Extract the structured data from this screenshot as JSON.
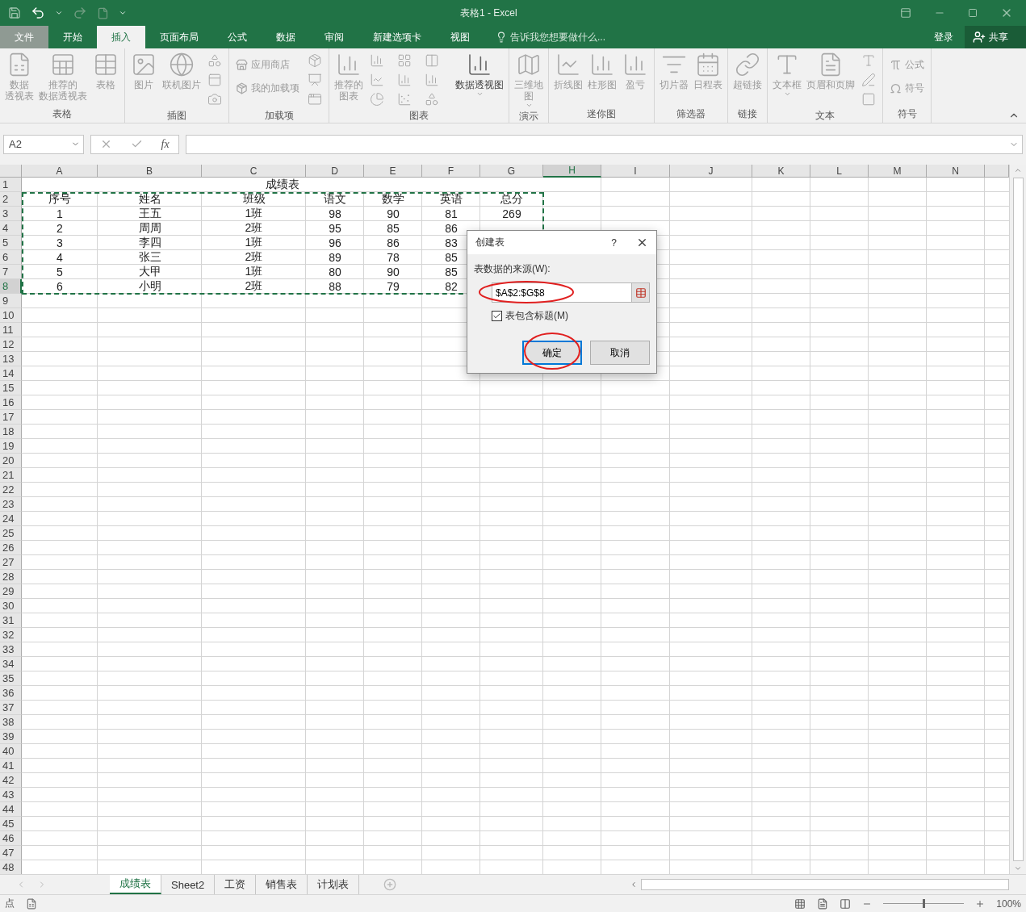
{
  "window": {
    "title": "表格1 - Excel"
  },
  "menu_tabs": [
    {
      "label": "文件",
      "selected": false,
      "kind": "file"
    },
    {
      "label": "开始",
      "selected": false,
      "kind": "tab"
    },
    {
      "label": "插入",
      "selected": true,
      "kind": "tab"
    },
    {
      "label": "页面布局",
      "selected": false,
      "kind": "tab"
    },
    {
      "label": "公式",
      "selected": false,
      "kind": "tab"
    },
    {
      "label": "数据",
      "selected": false,
      "kind": "tab"
    },
    {
      "label": "审阅",
      "selected": false,
      "kind": "tab"
    },
    {
      "label": "新建选项卡",
      "selected": false,
      "kind": "tab"
    },
    {
      "label": "视图",
      "selected": false,
      "kind": "tab"
    }
  ],
  "tell_me": {
    "placeholder": "告诉我您想要做什么..."
  },
  "sign_in": "登录",
  "share": "共享",
  "ribbon": [
    {
      "label": "表格",
      "items": [
        {
          "kind": "large",
          "lines": [
            "数据",
            "透视表"
          ],
          "disabled": true,
          "menu": false
        },
        {
          "kind": "large",
          "lines": [
            "推荐的",
            "数据透视表"
          ],
          "disabled": true,
          "menu": false
        },
        {
          "kind": "large",
          "lines": [
            "表格"
          ],
          "disabled": true,
          "menu": false
        }
      ]
    },
    {
      "label": "插图",
      "items": [
        {
          "kind": "large",
          "lines": [
            "图片"
          ],
          "disabled": true,
          "menu": false
        },
        {
          "kind": "large",
          "lines": [
            "联机图片"
          ],
          "disabled": true,
          "menu": false
        },
        {
          "kind": "icon-column"
        }
      ]
    },
    {
      "label": "加载项",
      "items": [
        {
          "kind": "small-column",
          "rows": [
            "应用商店",
            "我的加载项"
          ]
        },
        {
          "kind": "icon-column"
        }
      ]
    },
    {
      "label": "图表",
      "items": [
        {
          "kind": "large",
          "lines": [
            "推荐的",
            "图表"
          ],
          "disabled": true,
          "menu": false
        },
        {
          "kind": "icon-grid"
        },
        {
          "kind": "large",
          "lines": [
            "数据透视图"
          ],
          "disabled": false,
          "menu": true
        }
      ]
    },
    {
      "label": "演示",
      "items": [
        {
          "kind": "large",
          "lines": [
            "三维地",
            "图"
          ],
          "disabled": true,
          "menu": true
        }
      ]
    },
    {
      "label": "迷你图",
      "items": [
        {
          "kind": "large",
          "lines": [
            "折线图"
          ],
          "disabled": true,
          "menu": false
        },
        {
          "kind": "large",
          "lines": [
            "柱形图"
          ],
          "disabled": true,
          "menu": false
        },
        {
          "kind": "large",
          "lines": [
            "盈亏"
          ],
          "disabled": true,
          "menu": false
        }
      ]
    },
    {
      "label": "筛选器",
      "items": [
        {
          "kind": "large",
          "lines": [
            "切片器"
          ],
          "disabled": true,
          "menu": false
        },
        {
          "kind": "large",
          "lines": [
            "日程表"
          ],
          "disabled": true,
          "menu": false
        }
      ]
    },
    {
      "label": "链接",
      "items": [
        {
          "kind": "large",
          "lines": [
            "超链接"
          ],
          "disabled": true,
          "menu": false
        }
      ]
    },
    {
      "label": "文本",
      "items": [
        {
          "kind": "large",
          "lines": [
            "文本框"
          ],
          "disabled": true,
          "menu": true
        },
        {
          "kind": "large",
          "lines": [
            "页眉和页脚"
          ],
          "disabled": true,
          "menu": false
        },
        {
          "kind": "icon-column"
        }
      ]
    },
    {
      "label": "符号",
      "items": [
        {
          "kind": "small-column",
          "rows": [
            "公式",
            "符号"
          ]
        }
      ]
    }
  ],
  "formula_bar": {
    "name_box": "A2",
    "function_button": "fx"
  },
  "sheet": {
    "columns": [
      {
        "label": "A",
        "selected": false
      },
      {
        "label": "B",
        "selected": false
      },
      {
        "label": "C",
        "selected": false
      },
      {
        "label": "D",
        "selected": false
      },
      {
        "label": "E",
        "selected": false
      },
      {
        "label": "F",
        "selected": false
      },
      {
        "label": "G",
        "selected": false
      },
      {
        "label": "H",
        "selected": true
      },
      {
        "label": "I",
        "selected": false
      },
      {
        "label": "J",
        "selected": false
      },
      {
        "label": "K",
        "selected": false
      },
      {
        "label": "L",
        "selected": false
      },
      {
        "label": "M",
        "selected": false
      },
      {
        "label": "N",
        "selected": false
      }
    ],
    "title_cell": "成绩表",
    "rows": [
      [
        "序号",
        "姓名",
        "班级",
        "语文",
        "数学",
        "英语",
        "总分"
      ],
      [
        "1",
        "王五",
        "1班",
        "98",
        "90",
        "81",
        "269"
      ],
      [
        "2",
        "周周",
        "2班",
        "95",
        "85",
        "86"
      ],
      [
        "3",
        "李四",
        "1班",
        "96",
        "86",
        "83"
      ],
      [
        "4",
        "张三",
        "2班",
        "89",
        "78",
        "85"
      ],
      [
        "5",
        "大甲",
        "1班",
        "80",
        "90",
        "85"
      ],
      [
        "6",
        "小明",
        "2班",
        "88",
        "79",
        "82"
      ]
    ],
    "row_numbers": [
      {
        "label": "1",
        "selected": false
      },
      {
        "label": "2",
        "selected": false
      },
      {
        "label": "3",
        "selected": false
      },
      {
        "label": "4",
        "selected": false
      },
      {
        "label": "5",
        "selected": false
      },
      {
        "label": "6",
        "selected": false
      },
      {
        "label": "7",
        "selected": false
      },
      {
        "label": "8",
        "selected": true
      },
      {
        "label": "9",
        "selected": false
      },
      {
        "label": "10",
        "selected": false
      },
      {
        "label": "11",
        "selected": false
      },
      {
        "label": "12",
        "selected": false
      },
      {
        "label": "13",
        "selected": false
      },
      {
        "label": "14",
        "selected": false
      },
      {
        "label": "15",
        "selected": false
      },
      {
        "label": "16",
        "selected": false
      },
      {
        "label": "17",
        "selected": false
      },
      {
        "label": "18",
        "selected": false
      },
      {
        "label": "19",
        "selected": false
      },
      {
        "label": "20",
        "selected": false
      },
      {
        "label": "21",
        "selected": false
      },
      {
        "label": "22",
        "selected": false
      },
      {
        "label": "23",
        "selected": false
      },
      {
        "label": "24",
        "selected": false
      },
      {
        "label": "25",
        "selected": false
      },
      {
        "label": "26",
        "selected": false
      },
      {
        "label": "27",
        "selected": false
      },
      {
        "label": "28",
        "selected": false
      },
      {
        "label": "29",
        "selected": false
      },
      {
        "label": "30",
        "selected": false
      },
      {
        "label": "31",
        "selected": false
      },
      {
        "label": "32",
        "selected": false
      },
      {
        "label": "33",
        "selected": false
      },
      {
        "label": "34",
        "selected": false
      },
      {
        "label": "35",
        "selected": false
      },
      {
        "label": "36",
        "selected": false
      },
      {
        "label": "37",
        "selected": false
      },
      {
        "label": "38",
        "selected": false
      },
      {
        "label": "39",
        "selected": false
      },
      {
        "label": "40",
        "selected": false
      },
      {
        "label": "41",
        "selected": false
      },
      {
        "label": "42",
        "selected": false
      },
      {
        "label": "43",
        "selected": false
      },
      {
        "label": "44",
        "selected": false
      },
      {
        "label": "45",
        "selected": false
      },
      {
        "label": "46",
        "selected": false
      },
      {
        "label": "47",
        "selected": false
      },
      {
        "label": "48",
        "selected": false
      }
    ]
  },
  "dialog": {
    "title": "创建表",
    "help": "?",
    "source_label": "表数据的来源(W):",
    "source_value": "$A$2:$G$8",
    "header_checkbox": {
      "label": "表包含标题(M)",
      "checked": true
    },
    "buttons": [
      {
        "label": "确定",
        "focused": true
      },
      {
        "label": "取消",
        "focused": false
      }
    ]
  },
  "sheet_tabs": [
    {
      "label": "成绩表",
      "selected": true
    },
    {
      "label": "Sheet2",
      "selected": false
    },
    {
      "label": "工资",
      "selected": false
    },
    {
      "label": "销售表",
      "selected": false
    },
    {
      "label": "计划表",
      "selected": false
    }
  ],
  "status_bar": {
    "mode": "点",
    "zoom": {
      "level": 0.5,
      "reading": "100%"
    }
  }
}
